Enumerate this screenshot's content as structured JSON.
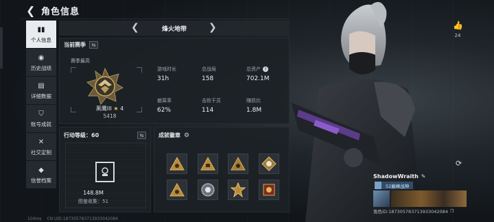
{
  "header": {
    "title": "角色信息"
  },
  "sidebar": {
    "items": [
      {
        "label": "个人信息",
        "active": true
      },
      {
        "label": "历史战绩"
      },
      {
        "label": "详细数据"
      },
      {
        "label": "账号成就"
      },
      {
        "label": "社交定制"
      },
      {
        "label": "信誉档案"
      }
    ]
  },
  "mode": {
    "title": "烽火地带"
  },
  "season": {
    "header": "当前赛季",
    "sub_label": "赛季最高",
    "rank_name": "黑鹰III",
    "rank_stars": "4",
    "rank_score": "5418",
    "stats": [
      {
        "label": "游戏时长",
        "value": "31h"
      },
      {
        "label": "总战局",
        "value": "158"
      },
      {
        "label": "总资产",
        "value": "702.1M",
        "help": "?"
      },
      {
        "label": "撤离率",
        "value": "62%"
      },
      {
        "label": "击败干员",
        "value": "114"
      },
      {
        "label": "赚损比",
        "value": "1.8M"
      }
    ]
  },
  "action": {
    "header": "行动等级：",
    "level": "60",
    "collection_value": "148.8M",
    "collection_label": "图鉴收集：51"
  },
  "achievements": {
    "header": "成就徽章",
    "badges": [
      "gold-triangle-badge",
      "gold-triangle-badge",
      "gold-triangle-badge",
      "gold-skull-badge",
      "gold-triangle-badge",
      "silver-emblem-badge",
      "gold-emblem-badge",
      "red-gold-badge"
    ]
  },
  "profile": {
    "likes": "24",
    "player_name": "ShadowWraith",
    "rank_tag": "52巅峰战神",
    "uid": "角色ID:187305783713933042084"
  },
  "footer": {
    "ping": "104ms",
    "uid": "CN UID:187305783713933042084"
  },
  "colors": {
    "accent_gold": "#e6c25a",
    "active_tab": "#e9ecee",
    "rank_tag_bg": "#2f4d6a"
  }
}
